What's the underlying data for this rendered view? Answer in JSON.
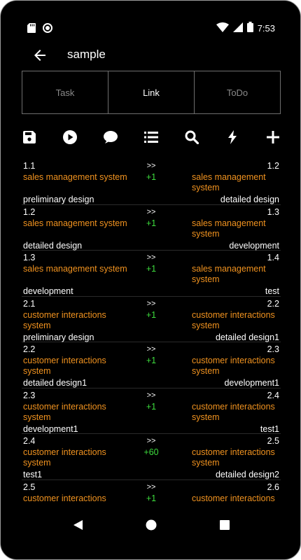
{
  "status": {
    "time": "7:53"
  },
  "appbar": {
    "title": "sample"
  },
  "tabs": [
    {
      "label": "Task",
      "active": false
    },
    {
      "label": "Link",
      "active": true
    },
    {
      "label": "ToDo",
      "active": false
    }
  ],
  "toolbar": [
    "save-icon",
    "play-icon",
    "comment-icon",
    "list-icon",
    "search-icon",
    "bolt-icon",
    "add-icon"
  ],
  "colors": {
    "accent": "#f0921f",
    "positive": "#3ddc3d",
    "background": "#000000"
  },
  "links": [
    {
      "from_id": "1.1",
      "arrow": ">>",
      "to_id": "1.2",
      "diff": "+1",
      "from_system": "sales management system",
      "to_system": "sales management system",
      "from_phase": "preliminary design",
      "to_phase": "detailed design"
    },
    {
      "from_id": "1.2",
      "arrow": ">>",
      "to_id": "1.3",
      "diff": "+1",
      "from_system": "sales management system",
      "to_system": "sales management system",
      "from_phase": "detailed design",
      "to_phase": "development"
    },
    {
      "from_id": "1.3",
      "arrow": ">>",
      "to_id": "1.4",
      "diff": "+1",
      "from_system": "sales management system",
      "to_system": "sales management system",
      "from_phase": "development",
      "to_phase": "test"
    },
    {
      "from_id": "2.1",
      "arrow": ">>",
      "to_id": "2.2",
      "diff": "+1",
      "from_system": "customer interactions system",
      "to_system": "customer interactions system",
      "from_phase": "preliminary design",
      "to_phase": "detailed design1"
    },
    {
      "from_id": "2.2",
      "arrow": ">>",
      "to_id": "2.3",
      "diff": "+1",
      "from_system": "customer interactions system",
      "to_system": "customer interactions system",
      "from_phase": "detailed design1",
      "to_phase": "development1"
    },
    {
      "from_id": "2.3",
      "arrow": ">>",
      "to_id": "2.4",
      "diff": "+1",
      "from_system": "customer interactions system",
      "to_system": "customer interactions system",
      "from_phase": "development1",
      "to_phase": "test1"
    },
    {
      "from_id": "2.4",
      "arrow": ">>",
      "to_id": "2.5",
      "diff": "+60",
      "from_system": "customer interactions system",
      "to_system": "customer interactions system",
      "from_phase": "test1",
      "to_phase": "detailed design2"
    },
    {
      "from_id": "2.5",
      "arrow": ">>",
      "to_id": "2.6",
      "diff": "+1",
      "from_system": "customer interactions",
      "to_system": "customer interactions",
      "from_phase": "",
      "to_phase": ""
    }
  ]
}
